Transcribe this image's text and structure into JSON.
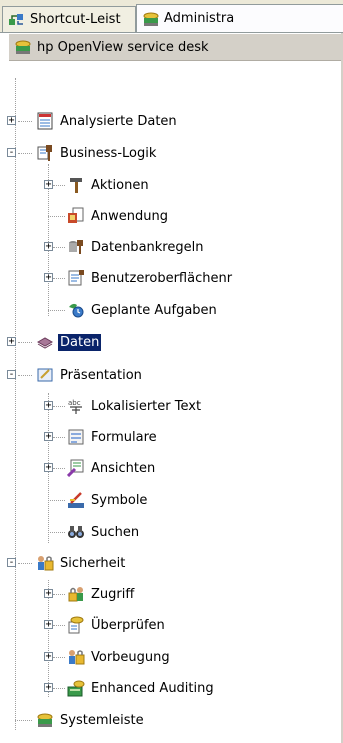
{
  "tabs": [
    {
      "label": "Shortcut-Leist",
      "icon": "shortcut-icon",
      "active": false
    },
    {
      "label": "Administra",
      "icon": "admin-icon",
      "active": true
    }
  ],
  "header": {
    "label": "hp OpenView service desk",
    "icon": "servicedesk-icon"
  },
  "tree": [
    {
      "id": "analysierte-daten",
      "label": "Analysierte Daten",
      "icon": "data-table-icon",
      "expander": "+"
    },
    {
      "id": "business-logik",
      "label": "Business-Logik",
      "icon": "business-logic-icon",
      "expander": "-"
    },
    {
      "id": "aktionen",
      "label": "Aktionen",
      "icon": "hammer-icon",
      "expander": "+"
    },
    {
      "id": "anwendung",
      "label": "Anwendung",
      "icon": "application-icon",
      "expander": ""
    },
    {
      "id": "datenbankregeln",
      "label": "Datenbankregeln",
      "icon": "db-rules-icon",
      "expander": "+"
    },
    {
      "id": "benutzeroberflaechen",
      "label": "Benutzeroberflächenr",
      "icon": "ui-rules-icon",
      "expander": "+"
    },
    {
      "id": "geplante-aufgaben",
      "label": "Geplante Aufgaben",
      "icon": "scheduled-task-icon",
      "expander": ""
    },
    {
      "id": "daten",
      "label": "Daten",
      "icon": "data-icon",
      "expander": "+",
      "selected": true
    },
    {
      "id": "praesentation",
      "label": "Präsentation",
      "icon": "presentation-icon",
      "expander": "-"
    },
    {
      "id": "lokalisierter-text",
      "label": "Lokalisierter Text",
      "icon": "localized-text-icon",
      "expander": "+"
    },
    {
      "id": "formulare",
      "label": "Formulare",
      "icon": "form-icon",
      "expander": "+"
    },
    {
      "id": "ansichten",
      "label": "Ansichten",
      "icon": "views-icon",
      "expander": "+"
    },
    {
      "id": "symbole",
      "label": "Symbole",
      "icon": "symbols-icon",
      "expander": ""
    },
    {
      "id": "suchen",
      "label": "Suchen",
      "icon": "binoculars-icon",
      "expander": ""
    },
    {
      "id": "sicherheit",
      "label": "Sicherheit",
      "icon": "security-icon",
      "expander": "-"
    },
    {
      "id": "zugriff",
      "label": "Zugriff",
      "icon": "access-icon",
      "expander": "+"
    },
    {
      "id": "ueberpruefen",
      "label": "Überprüfen",
      "icon": "audit-icon",
      "expander": "+"
    },
    {
      "id": "vorbeugung",
      "label": "Vorbeugung",
      "icon": "prevention-icon",
      "expander": "+"
    },
    {
      "id": "enhanced-auditing",
      "label": "Enhanced Auditing",
      "icon": "enhanced-auditing-icon",
      "expander": "+"
    },
    {
      "id": "systemleiste",
      "label": "Systemleiste",
      "icon": "systembar-icon",
      "expander": ""
    }
  ],
  "colors": {
    "selection": "#0a246a",
    "background": "#ffffff",
    "chrome": "#d4d0c8"
  }
}
